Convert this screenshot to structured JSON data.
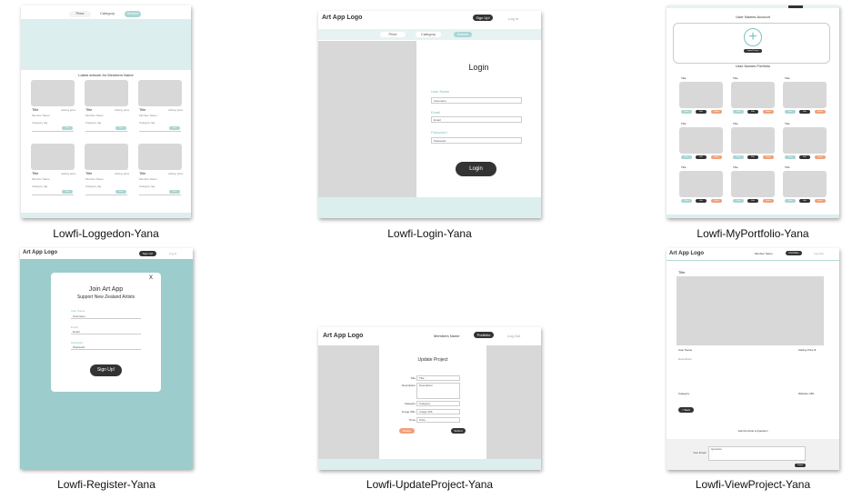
{
  "captions": {
    "loggedon": "Lowfi-Loggedon-Yana",
    "login": "Lowfi-Login-Yana",
    "myportfolio": "Lowfi-MyPortfolio-Yana",
    "register": "Lowfi-Register-Yana",
    "updateproject": "Lowfi-UpdateProject-Yana",
    "viewproject": "Lowfi-ViewProject-Yana"
  },
  "loggedon": {
    "nav": [
      "Price",
      "Category",
      "Search"
    ],
    "heading": "Latest artwork for Members Name",
    "card_title": "Title",
    "card_price": "Asking price",
    "card_user": "Member Name",
    "card_category": "Category tag",
    "card_view": "View"
  },
  "login": {
    "logo": "Art App Logo",
    "signup": "Sign Up!",
    "login_link": "Log In",
    "nav": [
      "Price",
      "Category",
      "Search"
    ],
    "title": "Login",
    "username_label": "User Name",
    "username_value": "Username",
    "email_label": "Email",
    "email_value": "Email",
    "password_label": "Password",
    "password_value": "Password",
    "button": "Login"
  },
  "myportfolio": {
    "header": "User Names Account",
    "upload": "Upload Project",
    "portfolio_heading": "User Names Portfolio",
    "card_title": "Title",
    "btn_view": "View",
    "btn_edit": "Edit",
    "btn_delete": "Delete"
  },
  "register": {
    "logo": "Art App Logo",
    "signup": "Sign Up!",
    "login_link": "Log In",
    "close": "X",
    "title": "Join Art App",
    "subtitle": "Support New Zealand Artists",
    "username_label": "User Name",
    "username_value": "Username",
    "email_label": "Email",
    "email_value": "Email",
    "password_label": "Password",
    "password_value": "Password",
    "button": "Sign Up!"
  },
  "updateproject": {
    "logo": "Art App Logo",
    "member": "Members Name",
    "portfolio": "Portfolio",
    "logout": "Log Out",
    "title": "Update Project",
    "rows": [
      {
        "label": "Title",
        "value": "Title"
      },
      {
        "label": "Description",
        "value": "Description"
      },
      {
        "label": "Category",
        "value": "Category"
      },
      {
        "label": "Image URL",
        "value": "Image URL"
      },
      {
        "label": "Price",
        "value": "Price"
      }
    ],
    "delete": "Delete",
    "submit": "Submit"
  },
  "viewproject": {
    "logo": "Art App Logo",
    "member": "Member Name",
    "portfolio": "Portfolio",
    "logout": "Log Out",
    "title": "Title",
    "user_name": "User Name",
    "asking_price": "Asking Price $",
    "description": "Description",
    "category": "Category",
    "website": "Website URL",
    "back": "< Back",
    "ask": "Ask the Artist a Question",
    "your_email": "Your Email",
    "question_placeholder": "Question",
    "submit": "Submit"
  },
  "colors": {
    "teal_light": "#dceeee",
    "teal_dark": "#9ccccb",
    "button_dark": "#333333",
    "accent_orange": "#f2a07a",
    "placeholder_gray": "#d8d8d8"
  }
}
